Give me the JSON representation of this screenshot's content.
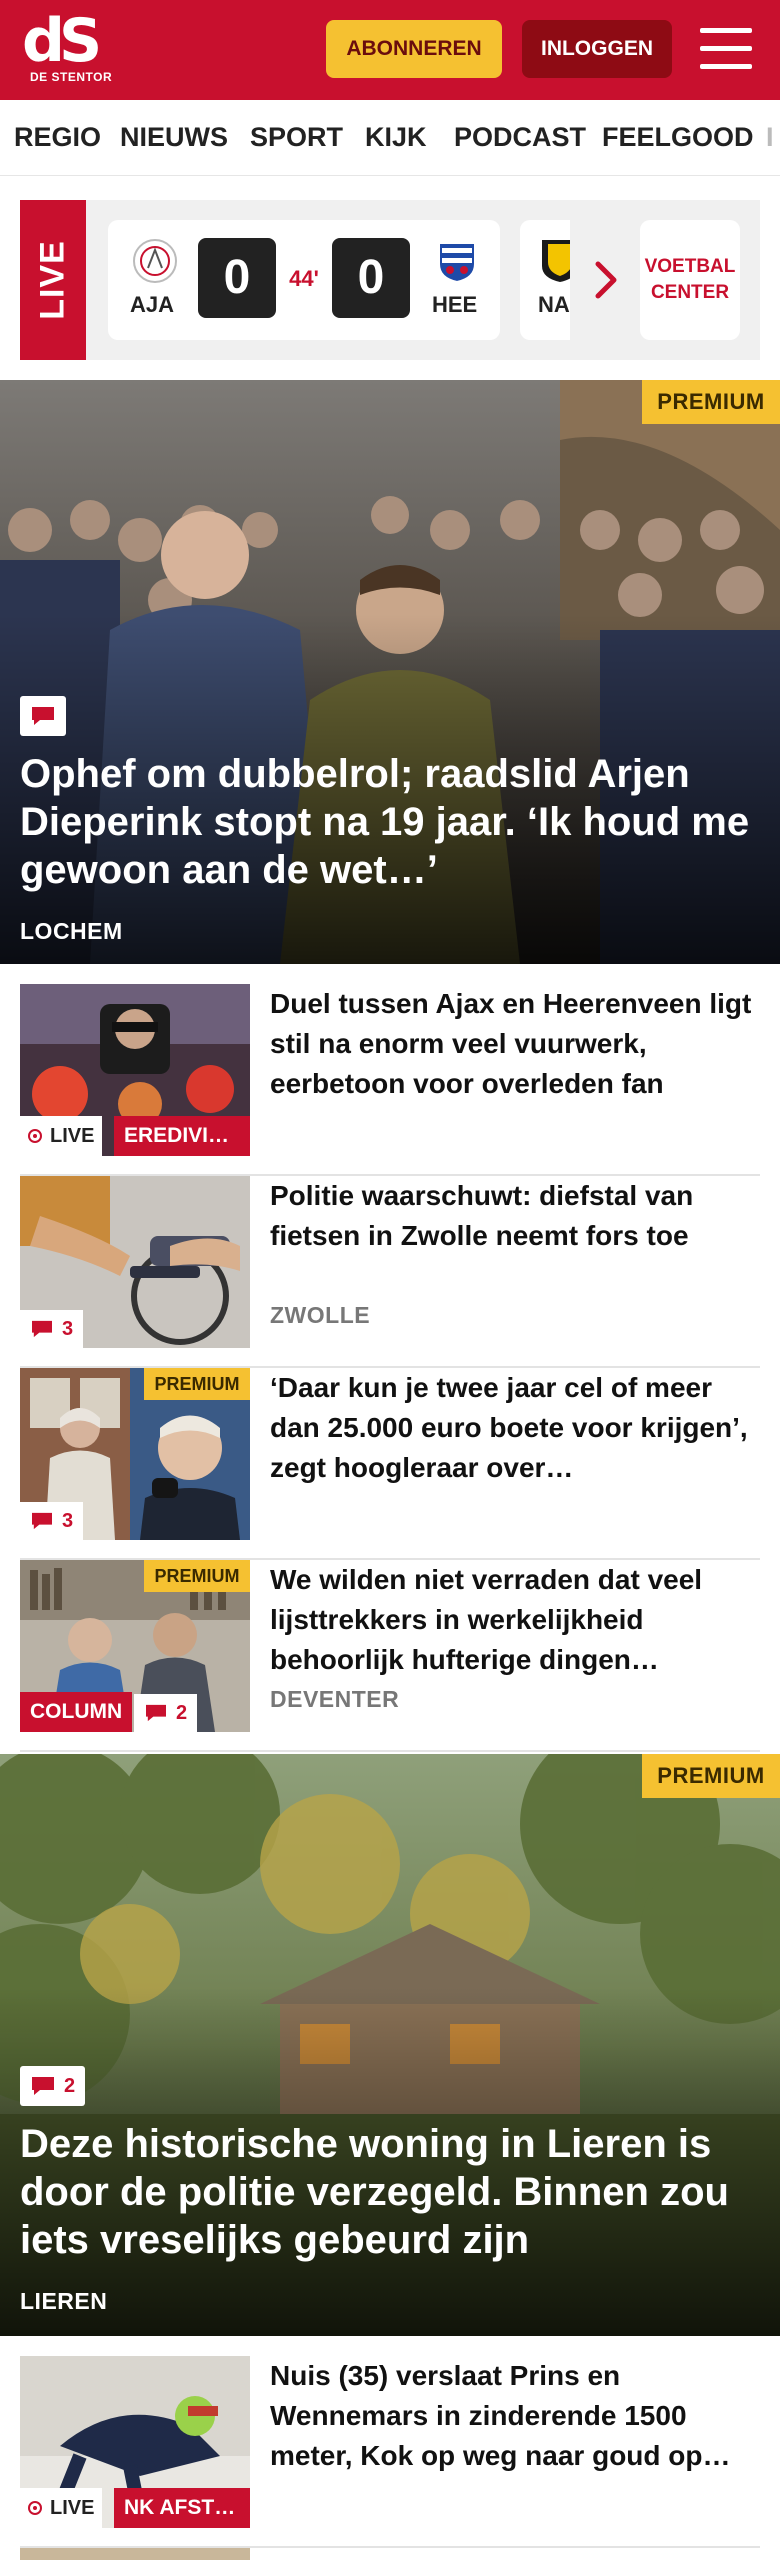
{
  "header": {
    "logo_mark": "dS",
    "logo_text": "DE STENTOR",
    "subscribe_label": "ABONNEREN",
    "login_label": "INLOGGEN"
  },
  "nav": {
    "items": [
      "REGIO",
      "NIEUWS",
      "SPORT",
      "KIJK",
      "PODCAST",
      "FEELGOOD",
      "I"
    ]
  },
  "livebar": {
    "label": "LIVE",
    "match": {
      "home": "AJA",
      "away": "HEE",
      "home_score": "0",
      "away_score": "0",
      "minute": "44'"
    },
    "next_match_team": "NA",
    "voetbal_center_label": "VOETBAL CENTER"
  },
  "hero1": {
    "premium": "PREMIUM",
    "comment_icon": "comment-icon",
    "title": "Ophef om dubbelrol; raadslid Arjen Dieperink stopt na 19 jaar. ‘Ik houd me gewoon aan de wet…’",
    "location": "LOCHEM"
  },
  "list1": [
    {
      "title": "Duel tussen Ajax en Heerenveen ligt stil na enorm veel vuurwerk, eerbetoon voor overleden fan",
      "live": "LIVE",
      "category": "EREDIVI…"
    },
    {
      "title": "Politie waarschuwt: diefstal van fietsen in Zwolle neemt fors toe",
      "location": "ZWOLLE",
      "comments": "3"
    },
    {
      "title": "‘Daar kun je twee jaar cel of meer dan 25.000 euro boete voor krijgen’, zegt hoogleraar over…",
      "premium": "PREMIUM",
      "comments": "3"
    },
    {
      "title": "We wilden niet verraden dat veel lijsttrekkers in werkelijkheid behoorlijk hufterige dingen…",
      "premium": "PREMIUM",
      "location": "DEVENTER",
      "category": "COLUMN",
      "comments": "2"
    }
  ],
  "hero2": {
    "premium": "PREMIUM",
    "comments": "2",
    "title": "Deze historische woning in Lieren is door de politie verzegeld. Binnen zou iets vreselijks gebeurd zijn",
    "location": "LIEREN"
  },
  "list2": [
    {
      "title": "Nuis (35) verslaat Prins en Wennemars in zinderende 1500 meter, Kok op weg naar goud op…",
      "live": "LIVE",
      "category": "NK AFST…"
    }
  ],
  "colors": {
    "brand_red": "#c8102e",
    "premium_yellow": "#f5c131",
    "login_dark_red": "#8e0b14"
  }
}
